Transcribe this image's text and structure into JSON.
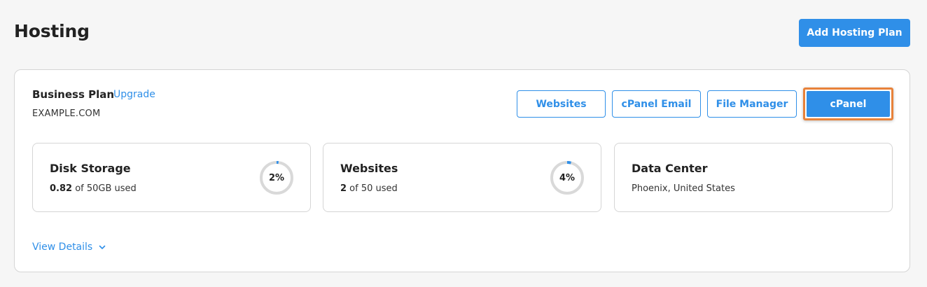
{
  "header": {
    "title": "Hosting",
    "add_button": "Add Hosting Plan"
  },
  "plan": {
    "name": "Business Plan",
    "upgrade_label": "Upgrade",
    "domain": "EXAMPLE.COM",
    "actions": {
      "websites": "Websites",
      "cpanel_email": "cPanel Email",
      "file_manager": "File Manager",
      "cpanel": "cPanel"
    },
    "highlight_color": "#e8823a",
    "accent_color": "#2f8fe8"
  },
  "stats": {
    "disk": {
      "title": "Disk Storage",
      "used": "0.82",
      "of_text": " of 50GB used",
      "percent_label": "2%",
      "percent": 2
    },
    "websites": {
      "title": "Websites",
      "used": "2",
      "of_text": " of 50 used",
      "percent_label": "4%",
      "percent": 4
    },
    "datacenter": {
      "title": "Data Center",
      "location": "Phoenix, United States"
    }
  },
  "footer": {
    "view_details": "View Details"
  }
}
